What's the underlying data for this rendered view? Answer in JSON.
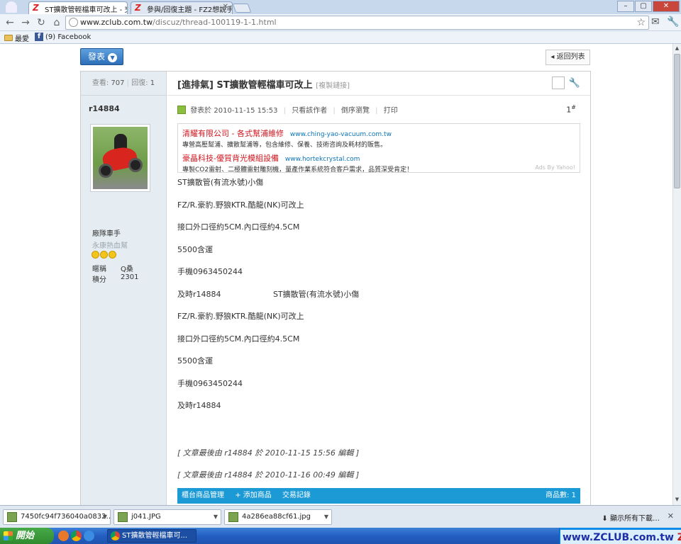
{
  "browser": {
    "tabs": [
      {
        "title": "ST擴散管輕檔車可改上 - 交",
        "active": true
      },
      {
        "title": "參與/回復主題 - FZ2想說手",
        "active": false
      }
    ],
    "window_buttons": {
      "minimize": "–",
      "maximize": "▢",
      "close": "✕"
    },
    "url_host": "www.zclub.com.tw",
    "url_path": "/discuz/thread-100119-1-1.html",
    "bookmarks": [
      {
        "label": "最愛"
      },
      {
        "label": "(9) Facebook"
      }
    ]
  },
  "page": {
    "post_button": "發表",
    "back_button": "返回列表",
    "stats": {
      "views_label": "查看:",
      "views": "707",
      "replies_label": "回復:",
      "replies": "1"
    },
    "title_category": "[進排氣]",
    "title": "ST擴散管輕檔車可改上",
    "copy_link": "[複製鏈接]",
    "author": "r14884",
    "rank": "廠隊車手",
    "subrank": "永康熱血幫",
    "profile": [
      {
        "label": "暱稱",
        "value": "Q桑"
      },
      {
        "label": "積分",
        "value": "2301"
      }
    ],
    "meta": {
      "posted": "發表於 2010-11-15 15:53",
      "author_only": "只看該作者",
      "reverse": "倒序瀏覽",
      "print": "打印",
      "floor": "1",
      "floor_sup": "#"
    },
    "ads": [
      {
        "title": "清耀有限公司 - 各式幫浦維修",
        "url": "www.ching-yao-vacuum.com.tw",
        "desc": "專營高壓幫浦、擴散幫浦等，包含維修、保養、技術咨詢及耗材的販售。"
      },
      {
        "title": "豪晶科技-優質背光模組設備",
        "url": "www.hortekcrystal.com",
        "desc": "專製CO2雷射、二極體雷射雕刻機，量產作業系統符合客戶需求，品質深受肯定！"
      }
    ],
    "ads_by": "Ads By Yahoo!",
    "body_lines": [
      "ST擴散管(有流水號)小傷",
      "FZ/R.豪豹.野狼KTR.酷龍(NK)可改上",
      "接口外口徑約5CM.內口徑約4.5CM",
      "5500含運",
      "手機0963450244",
      "及時r14884                     ST擴散管(有流水號)小傷",
      "FZ/R.豪豹.野狼KTR.酷龍(NK)可改上",
      "接口外口徑約5CM.內口徑約4.5CM",
      "5500含運",
      "手機0963450244",
      "及時r14884"
    ],
    "edit_notes": [
      "[ 文章最後由 r14884 於 2010-11-15 15:56 編輯 ]",
      "[ 文章最後由 r14884 於 2010-11-16 00:49 編輯 ]"
    ],
    "shop_bar": {
      "manage": "櫃台商品管理",
      "add": "+ 添加商品",
      "records": "交易記錄",
      "count": "商品數: 1"
    }
  },
  "downloads": {
    "items": [
      {
        "name": "7450fc94f736040a0832….jpg"
      },
      {
        "name": "j041.JPG"
      },
      {
        "name": "4a286ea88cf61.jpg"
      }
    ],
    "show_all": "顯示所有下載…",
    "close": "✕"
  },
  "taskbar": {
    "start": "開始",
    "active_window": "ST擴散管輕檔車可..."
  },
  "watermark": {
    "site": "www.ZCLUB.com.tw",
    "suffix": "Z族"
  }
}
